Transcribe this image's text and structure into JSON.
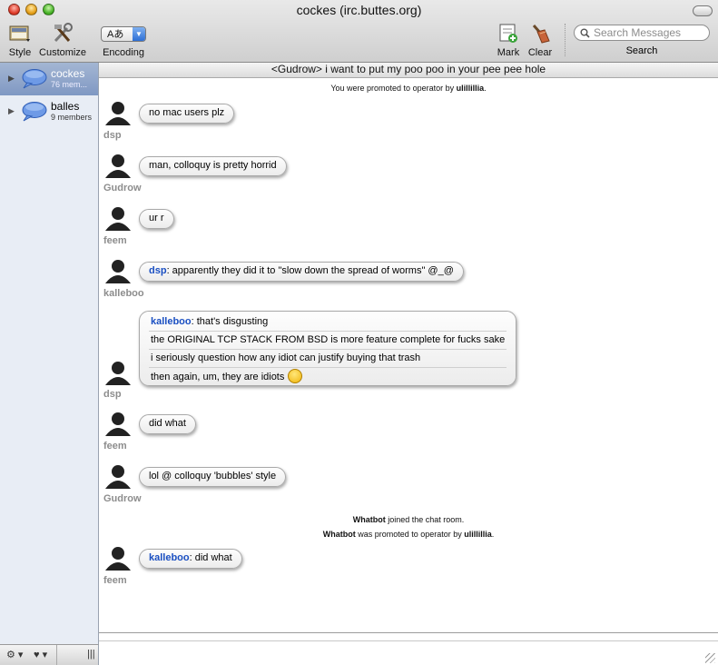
{
  "window": {
    "title": "cockes (irc.buttes.org)"
  },
  "toolbar": {
    "style_label": "Style",
    "customize_label": "Customize",
    "encoding_value": "Aあ",
    "encoding_label": "Encoding",
    "mark_label": "Mark",
    "clear_label": "Clear",
    "search_placeholder": "Search Messages",
    "search_label": "Search"
  },
  "sidebar": {
    "rooms": [
      {
        "name": "cockes",
        "members": "76 mem...",
        "selected": true
      },
      {
        "name": "balles",
        "members": "9 members",
        "selected": false
      }
    ]
  },
  "topic": "<Gudrow> i want to put my poo poo in your pee pee hole",
  "transcript": {
    "event1": {
      "pre": "You were promoted to operator by ",
      "by": "ulillillia",
      "post": "."
    },
    "messages": [
      {
        "sender": "dsp",
        "text": "no mac users plz"
      },
      {
        "sender": "Gudrow",
        "text": "man, colloquy is pretty horrid"
      },
      {
        "sender": "feem",
        "text": "ur r"
      },
      {
        "sender": "kalleboo",
        "mention": "dsp",
        "text": ": apparently they did it to \"slow down the spread of worms\" @_@"
      },
      {
        "sender": "dsp",
        "lines": [
          {
            "mention": "kalleboo",
            "text": ": that's disgusting"
          },
          {
            "text": "the ORIGINAL TCP STACK FROM BSD is more feature complete for fucks sake"
          },
          {
            "text": "i seriously question how any idiot can justify buying that trash"
          },
          {
            "text": "then again, um, they are idiots"
          }
        ]
      },
      {
        "sender": "feem",
        "text": "did what"
      },
      {
        "sender": "Gudrow",
        "text": "lol @ colloquy 'bubbles' style"
      },
      {
        "sender": "feem",
        "mention": "kalleboo",
        "text": ": did what"
      }
    ],
    "event2": {
      "who": "Whatbot",
      "text": " joined the chat room."
    },
    "event3": {
      "who": "Whatbot",
      "text": " was promoted to operator by ",
      "by": "ulillillia",
      "post": "."
    }
  },
  "colors": {
    "mention": "#1a4fc2",
    "sender": "#8d8d8d",
    "selection": "#7f98c3"
  }
}
